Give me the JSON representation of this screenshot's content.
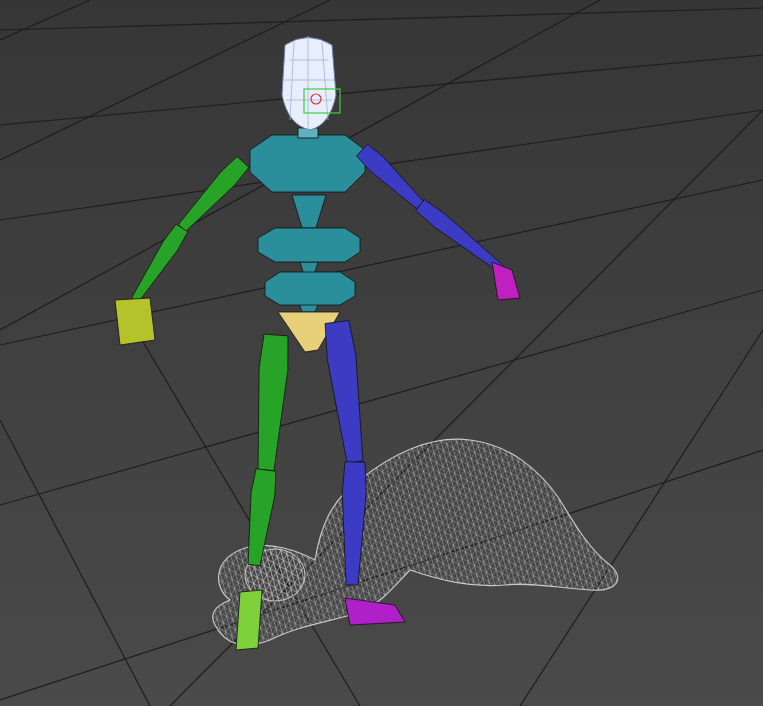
{
  "viewport": {
    "shading": "wireframe"
  },
  "biped": {
    "head_selected": true,
    "limbs": [
      {
        "side": "left",
        "color": "#27a327"
      },
      {
        "side": "right",
        "color": "#3b3bc4"
      }
    ],
    "torso_color": "#2a8f9a",
    "pelvis_color": "#e8cf7a"
  },
  "mesh": {
    "wireframe": true,
    "color": "#c8c8c8"
  }
}
